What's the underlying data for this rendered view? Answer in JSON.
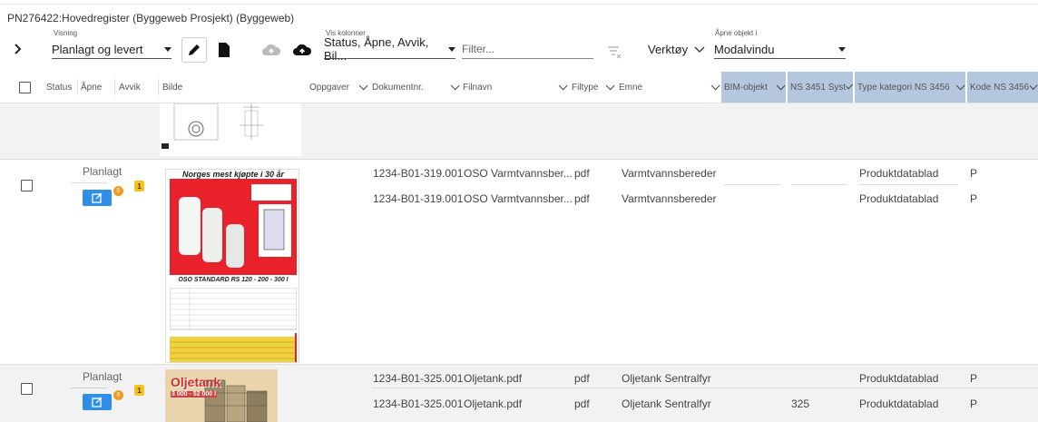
{
  "title": "PN276422:Hovedregister (Byggeweb Prosjekt) (Byggeweb)",
  "toolbar": {
    "visning_label": "Visning",
    "visning_value": "Planlagt og levert",
    "vis_kolonner_label": "Vis kolonner",
    "vis_kolonner_value": "Status, Åpne, Avvik, Bil...",
    "filter_placeholder": "Filter...",
    "verktoy_label": "Verktøy",
    "apne_label": "Åpne objekt i",
    "apne_value": "Modalvindu"
  },
  "columns": {
    "status": "Status",
    "apne": "Åpne",
    "avvik": "Avvik",
    "bilde": "Bilde",
    "oppgaver": "Oppgaver",
    "dokumentnr": "Dokumentnr.",
    "filnavn": "Filnavn",
    "filtype": "Filtype",
    "emne": "Emne",
    "bim": "BIM-objekt",
    "ns3451": "NS 3451 Syst",
    "type_kat": "Type kategori NS 3456",
    "kode": "Kode NS 3456"
  },
  "rows": [
    {
      "status": "Planlagt",
      "badge_count": "6",
      "avvik_count": "1",
      "image_heading": "Norges mest kjøpte i 30 år",
      "image_caption": "OSO STANDARD  RS 120 - 200 - 300 l",
      "lines": [
        {
          "dokumentnr": "1234-B01-319.001",
          "filnavn": "OSO Varmtvannsber...",
          "filtype": "pdf",
          "emne": "Varmtvannsbereder",
          "ns3451": "",
          "type_kat": "Produktdatablad",
          "kode": "P"
        },
        {
          "dokumentnr": "1234-B01-319.001",
          "filnavn": "OSO Varmtvannsber...",
          "filtype": "pdf",
          "emne": "Varmtvannsbereder",
          "ns3451": "",
          "type_kat": "Produktdatablad",
          "kode": "P"
        }
      ]
    },
    {
      "status": "Planlagt",
      "badge_count": "6",
      "avvik_count": "1",
      "image_heading": "Oljetank",
      "image_caption": "3 000 - 52 000 l",
      "lines": [
        {
          "dokumentnr": "1234-B01-325.001",
          "filnavn": "Oljetank.pdf",
          "filtype": "pdf",
          "emne": "Oljetank Sentralfyr",
          "ns3451": "",
          "type_kat": "Produktdatablad",
          "kode": "P"
        },
        {
          "dokumentnr": "1234-B01-325.001",
          "filnavn": "Oljetank.pdf",
          "filtype": "pdf",
          "emne": "Oljetank Sentralfyr",
          "ns3451": "325",
          "type_kat": "Produktdatablad",
          "kode": "P"
        }
      ]
    }
  ],
  "colors": {
    "accent": "#2f8ee5",
    "header_blue": "#b5c7df",
    "badge_orange": "#f39a1c",
    "badge_yellow": "#f6c21a",
    "poster_red": "#e8212a"
  }
}
